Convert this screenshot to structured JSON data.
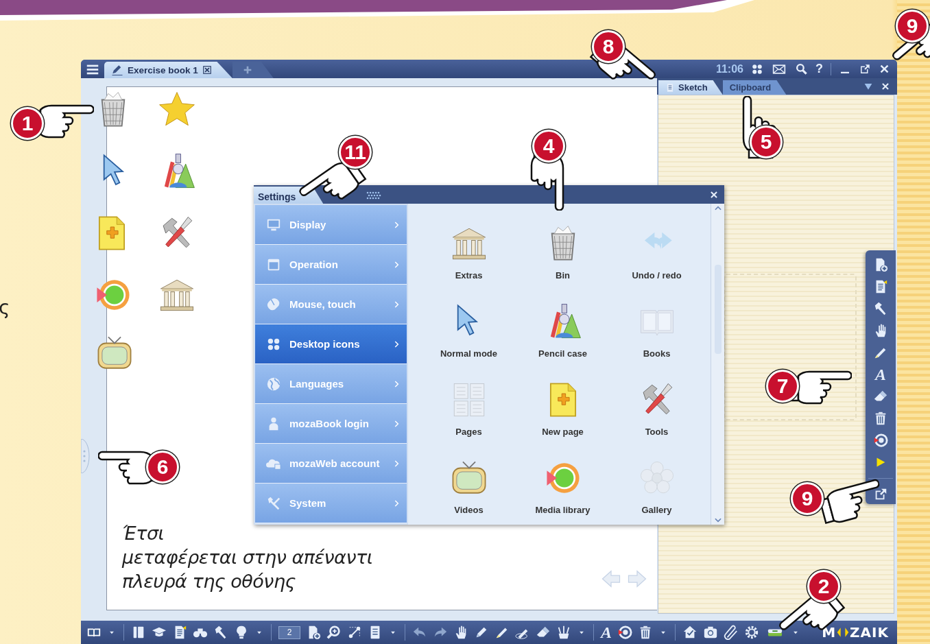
{
  "page": {
    "margin_text": "ς"
  },
  "window": {
    "tabs": [
      {
        "label": "Exercise book 1",
        "selected": true
      }
    ],
    "clock": "11:06",
    "help_glyph": "?"
  },
  "side_panel": {
    "tabs": [
      {
        "label": "Sketch",
        "selected": true
      },
      {
        "label": "Clipboard",
        "selected": false
      }
    ],
    "text_tool_glyph": "A"
  },
  "desktop": {
    "caption_lines": [
      "Έτσι",
      "μεταφέρεται στην απέναντι",
      "πλευρά της οθόνης"
    ]
  },
  "settings": {
    "title": "Settings",
    "menu": [
      {
        "label": "Display",
        "selected": false
      },
      {
        "label": "Operation",
        "selected": false
      },
      {
        "label": "Mouse, touch",
        "selected": false
      },
      {
        "label": "Desktop icons",
        "selected": true
      },
      {
        "label": "Languages",
        "selected": false
      },
      {
        "label": "mozaBook login",
        "selected": false
      },
      {
        "label": "mozaWeb account",
        "selected": false
      },
      {
        "label": "System",
        "selected": false
      }
    ],
    "items": [
      {
        "label": "Extras",
        "active": true
      },
      {
        "label": "Bin",
        "active": true
      },
      {
        "label": "Undo / redo",
        "active": false
      },
      {
        "label": "Normal mode",
        "active": true
      },
      {
        "label": "Pencil case",
        "active": true
      },
      {
        "label": "Books",
        "active": false
      },
      {
        "label": "Pages",
        "active": false
      },
      {
        "label": "New page",
        "active": true
      },
      {
        "label": "Tools",
        "active": true
      },
      {
        "label": "Videos",
        "active": true
      },
      {
        "label": "Media library",
        "active": true
      },
      {
        "label": "Gallery",
        "active": false
      }
    ]
  },
  "bottom_toolbar": {
    "page_number": "2",
    "text_tool_glyph": "A",
    "logo_left": "M",
    "logo_right": "ZAIK"
  },
  "callouts": [
    {
      "number": "1"
    },
    {
      "number": "8"
    },
    {
      "number": "9"
    },
    {
      "number": "11"
    },
    {
      "number": "4"
    },
    {
      "number": "5"
    },
    {
      "number": "7"
    },
    {
      "number": "9"
    },
    {
      "number": "6"
    },
    {
      "number": "2"
    }
  ]
}
